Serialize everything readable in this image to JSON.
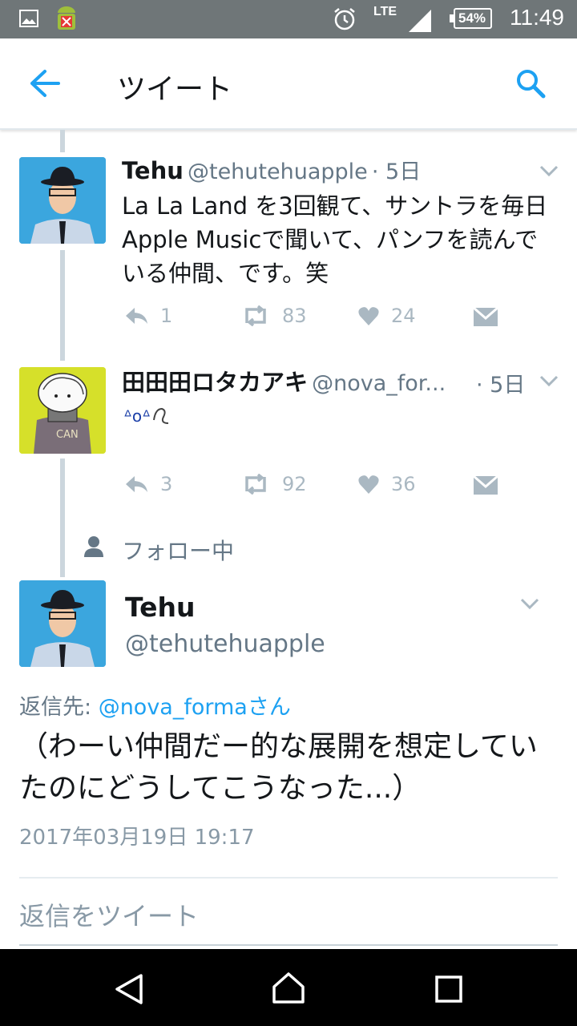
{
  "status_bar": {
    "time": "11:49",
    "battery": "54%",
    "network": "LTE",
    "icons": [
      "image-icon",
      "android-debug-icon",
      "alarm-icon",
      "signal-icon",
      "battery-icon"
    ]
  },
  "app_bar": {
    "title": "ツイート",
    "back_icon": "arrow-left-icon",
    "search_icon": "search-icon",
    "accent": "#1da1f2"
  },
  "tweets": [
    {
      "name": "Tehu",
      "handle": "@tehutehuapple",
      "time": "· 5日",
      "text": "La La Land を3回観て、サントラを毎日Apple Musicで聞いて、パンフを読んでいる仲間、です。笑",
      "replies": "1",
      "retweets": "83",
      "likes": "24"
    },
    {
      "name": "田田田ロタカアキ",
      "handle": "@nova_for...",
      "time": "· 5日",
      "text": "",
      "replies": "3",
      "retweets": "92",
      "likes": "36"
    }
  ],
  "following_label": "フォロー中",
  "main_tweet": {
    "name": "Tehu",
    "handle": "@tehutehuapple",
    "reply_to_prefix": "返信先: ",
    "reply_to_user": "@nova_forma",
    "reply_to_suffix": "さん",
    "text": "（わーい仲間だー的な展開を想定していたのにどうしてこうなった...）",
    "timestamp": "2017年03月19日 19:17"
  },
  "reply_placeholder": "返信をツイート",
  "nav_bar": {
    "icons": [
      "back-triangle-icon",
      "home-icon",
      "recents-icon"
    ]
  }
}
